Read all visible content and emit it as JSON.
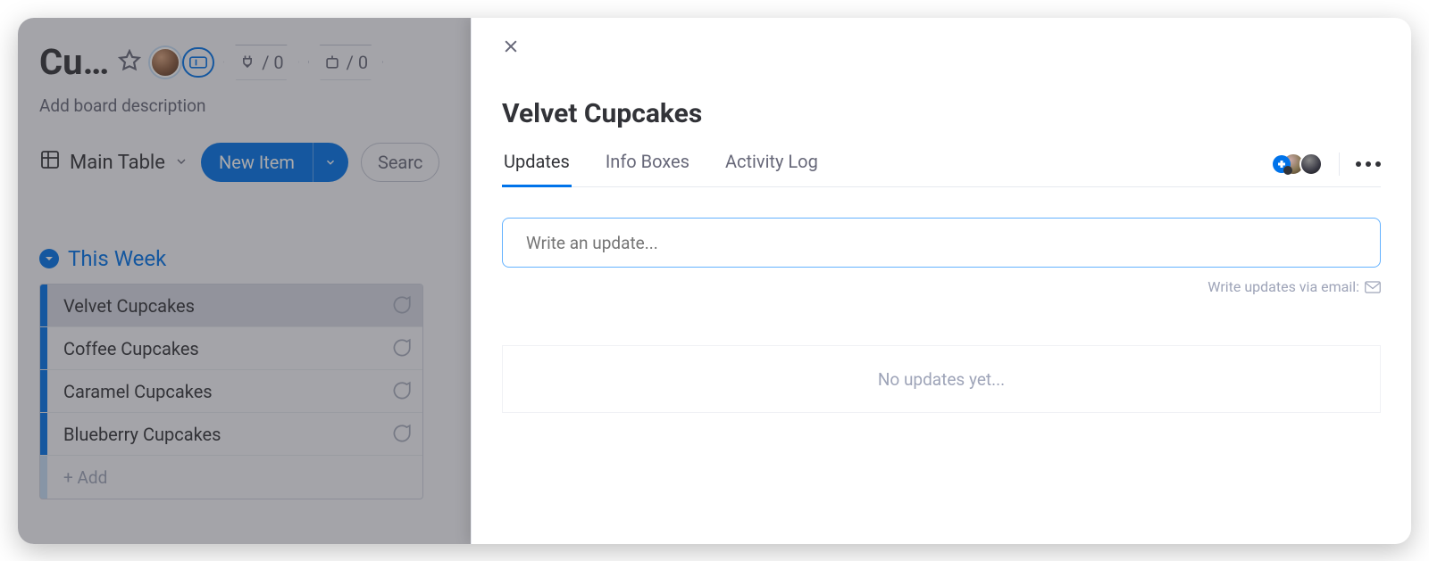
{
  "board": {
    "title": "Cu…",
    "description_placeholder": "Add board description",
    "integrations_count": "/ 0",
    "automations_count": "/ 0",
    "view_label": "Main Table",
    "new_item_label": "New Item",
    "search_placeholder": "Searc"
  },
  "group": {
    "title": "This Week",
    "rows": [
      "Velvet Cupcakes",
      "Coffee Cupcakes",
      "Caramel Cupcakes",
      "Blueberry Cupcakes"
    ],
    "add_label": "+ Add"
  },
  "panel": {
    "title": "Velvet Cupcakes",
    "tabs": [
      "Updates",
      "Info Boxes",
      "Activity Log"
    ],
    "update_placeholder": "Write an update...",
    "email_note": "Write updates via email:",
    "empty_text": "No updates yet..."
  }
}
